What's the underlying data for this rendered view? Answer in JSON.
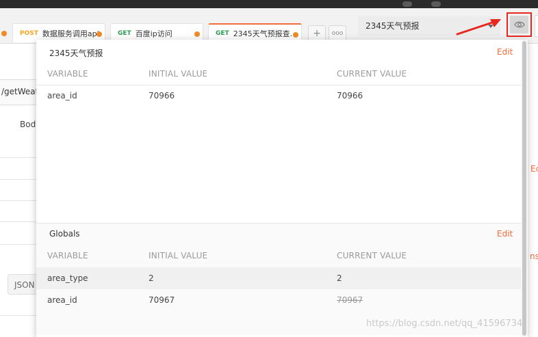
{
  "tabs": [
    {
      "method": "POST",
      "title": "数据服务调用api"
    },
    {
      "method": "GET",
      "title": "百度ip访问"
    },
    {
      "method": "GET",
      "title": "2345天气预报查..."
    }
  ],
  "tab_actions": {
    "add": "+",
    "more": "ooo"
  },
  "environment": {
    "selected": "2345天气预报",
    "quick_look_icon": "eye-icon"
  },
  "background": {
    "url_fragment": "/getWeath",
    "body_tab": "Body",
    "json_button": "JSON",
    "right_fragments": [
      "Ec",
      "ns"
    ]
  },
  "env_section": {
    "title": "2345天气预报",
    "edit": "Edit",
    "columns": {
      "variable": "VARIABLE",
      "initial": "INITIAL VALUE",
      "current": "CURRENT VALUE"
    },
    "rows": [
      {
        "variable": "area_id",
        "initial": "70966",
        "current": "70966"
      }
    ]
  },
  "globals_section": {
    "title": "Globals",
    "edit": "Edit",
    "columns": {
      "variable": "VARIABLE",
      "initial": "INITIAL VALUE",
      "current": "CURRENT VALUE"
    },
    "rows": [
      {
        "variable": "area_type",
        "initial": "2",
        "current": "2"
      },
      {
        "variable": "area_id",
        "initial": "70967",
        "current": "70967"
      }
    ]
  },
  "watermark": "https://blog.csdn.net/qq_41596734",
  "colors": {
    "accent": "#f26b3a",
    "annotation_red": "#e8261e",
    "get_green": "#2d9a55",
    "post_orange": "#f5a623"
  }
}
